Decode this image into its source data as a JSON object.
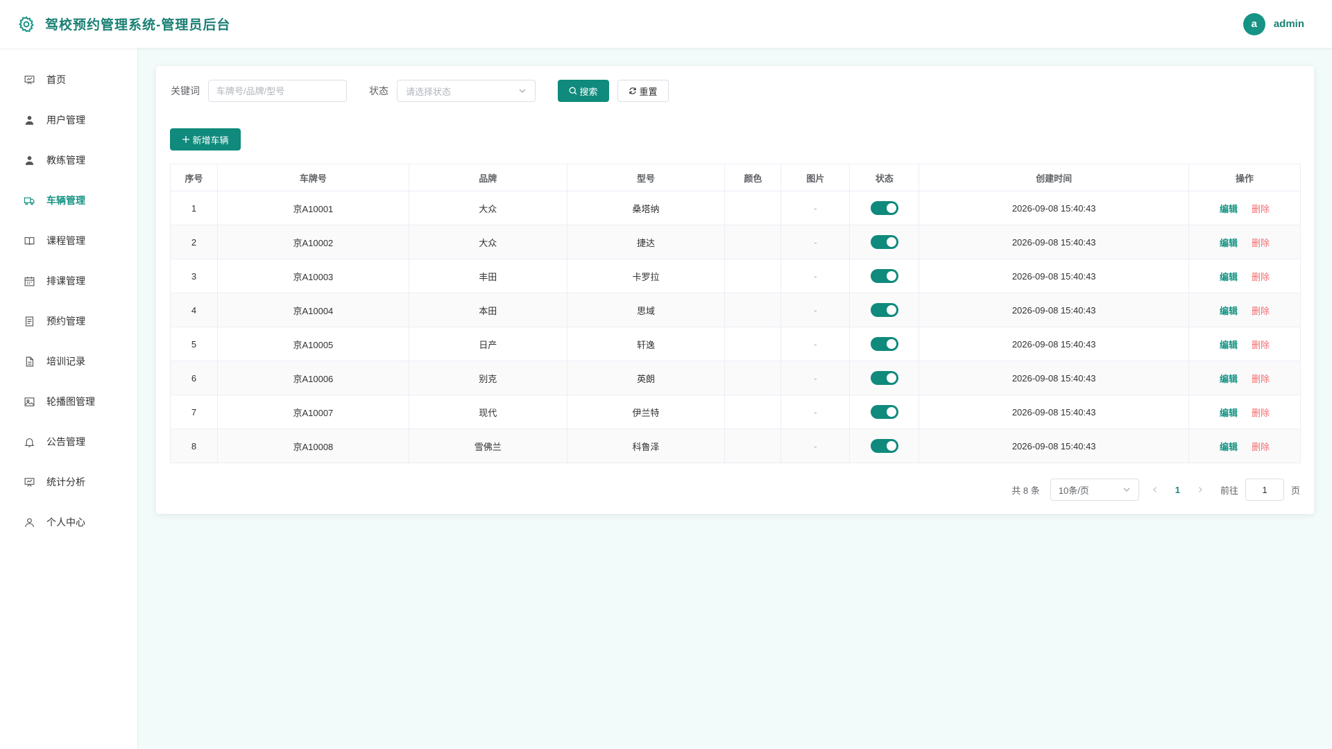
{
  "header": {
    "title": "驾校预约管理系统-管理员后台",
    "avatar_letter": "a",
    "username": "admin"
  },
  "sidebar": {
    "items": [
      {
        "label": "首页",
        "icon": "presentation-board-icon"
      },
      {
        "label": "用户管理",
        "icon": "user-icon"
      },
      {
        "label": "教练管理",
        "icon": "user-icon"
      },
      {
        "label": "车辆管理",
        "icon": "truck-icon",
        "active": true
      },
      {
        "label": "课程管理",
        "icon": "book-icon"
      },
      {
        "label": "排课管理",
        "icon": "calendar-icon"
      },
      {
        "label": "预约管理",
        "icon": "document-icon"
      },
      {
        "label": "培训记录",
        "icon": "file-icon"
      },
      {
        "label": "轮播图管理",
        "icon": "picture-icon"
      },
      {
        "label": "公告管理",
        "icon": "bell-icon"
      },
      {
        "label": "统计分析",
        "icon": "presentation-board-icon"
      },
      {
        "label": "个人中心",
        "icon": "user-outline-icon"
      }
    ]
  },
  "search": {
    "keyword_label": "关键词",
    "keyword_placeholder": "车牌号/品牌/型号",
    "status_label": "状态",
    "status_placeholder": "请选择状态",
    "search_button": "搜索",
    "reset_button": "重置"
  },
  "add_button": "新增车辆",
  "table": {
    "headers": [
      "序号",
      "车牌号",
      "品牌",
      "型号",
      "颜色",
      "图片",
      "状态",
      "创建时间",
      "操作"
    ],
    "rows": [
      {
        "no": "1",
        "plate": "京A10001",
        "brand": "大众",
        "model": "桑塔纳",
        "color": "",
        "image": "-",
        "status_on": true,
        "created": "2026-09-08 15:40:43"
      },
      {
        "no": "2",
        "plate": "京A10002",
        "brand": "大众",
        "model": "捷达",
        "color": "",
        "image": "-",
        "status_on": true,
        "created": "2026-09-08 15:40:43"
      },
      {
        "no": "3",
        "plate": "京A10003",
        "brand": "丰田",
        "model": "卡罗拉",
        "color": "",
        "image": "-",
        "status_on": true,
        "created": "2026-09-08 15:40:43"
      },
      {
        "no": "4",
        "plate": "京A10004",
        "brand": "本田",
        "model": "思域",
        "color": "",
        "image": "-",
        "status_on": true,
        "created": "2026-09-08 15:40:43"
      },
      {
        "no": "5",
        "plate": "京A10005",
        "brand": "日产",
        "model": "轩逸",
        "color": "",
        "image": "-",
        "status_on": true,
        "created": "2026-09-08 15:40:43"
      },
      {
        "no": "6",
        "plate": "京A10006",
        "brand": "别克",
        "model": "英朗",
        "color": "",
        "image": "-",
        "status_on": true,
        "created": "2026-09-08 15:40:43"
      },
      {
        "no": "7",
        "plate": "京A10007",
        "brand": "现代",
        "model": "伊兰特",
        "color": "",
        "image": "-",
        "status_on": true,
        "created": "2026-09-08 15:40:43"
      },
      {
        "no": "8",
        "plate": "京A10008",
        "brand": "雪佛兰",
        "model": "科鲁泽",
        "color": "",
        "image": "-",
        "status_on": true,
        "created": "2026-09-08 15:40:43"
      }
    ],
    "edit_label": "编辑",
    "delete_label": "删除"
  },
  "pagination": {
    "total_text": "共 8 条",
    "page_size": "10条/页",
    "current_page": "1",
    "goto_label": "前往",
    "goto_value": "1",
    "page_suffix": "页"
  },
  "colors": {
    "primary": "#0f8a7c",
    "danger": "#f56c6c",
    "background": "#f2fbfa"
  }
}
